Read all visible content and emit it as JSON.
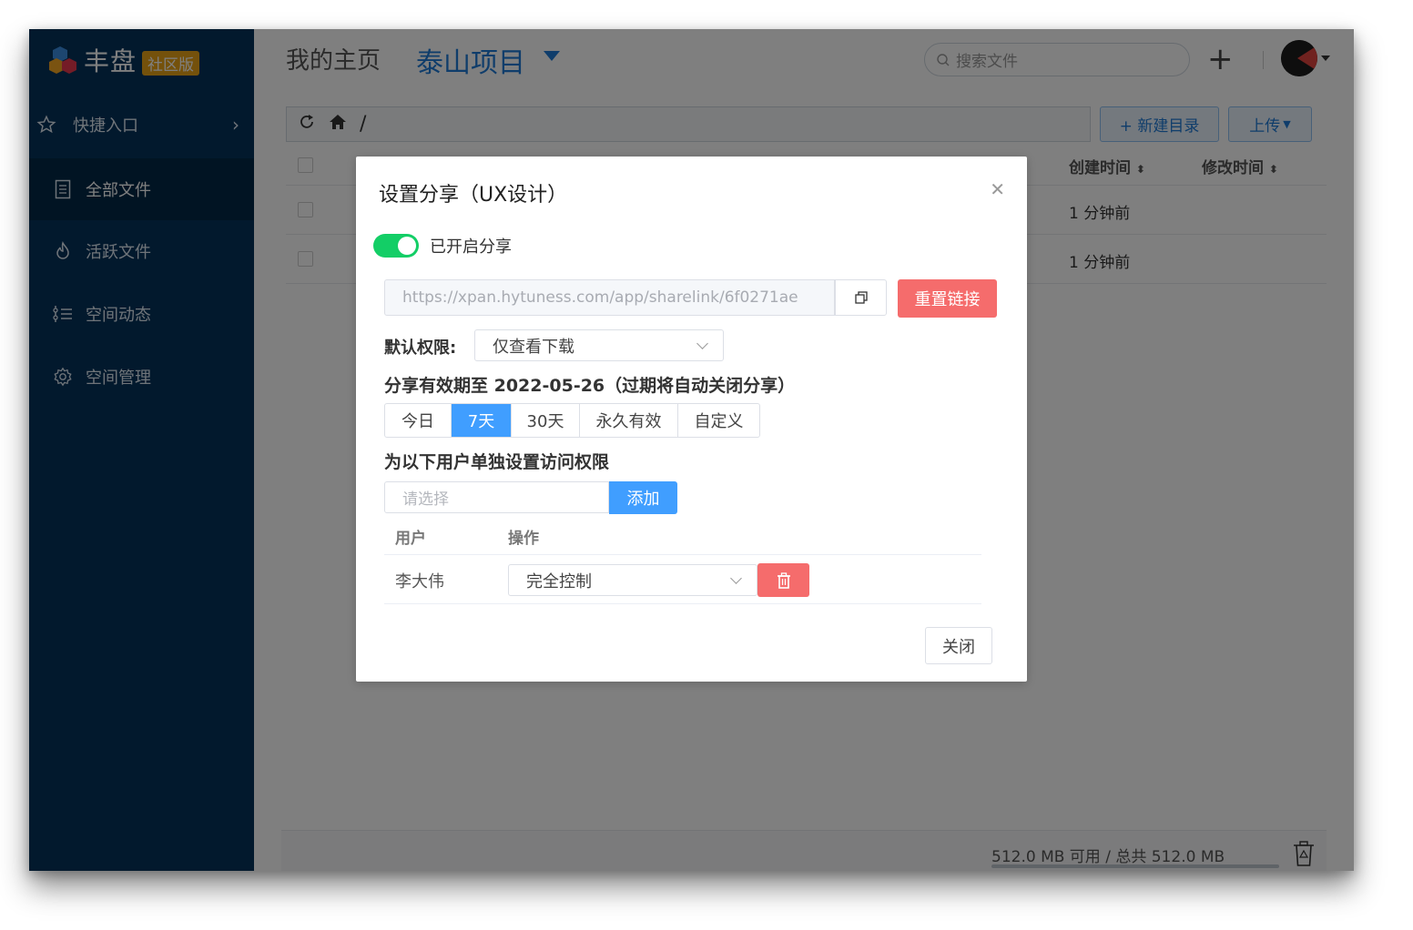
{
  "app": {
    "brand_name": "丰盘",
    "edition": "社区版",
    "accent_color": "#1f7ad6",
    "sidebar_color": "#04325a"
  },
  "sidebar": {
    "quick_entry": "快捷入口",
    "items": [
      {
        "label": "全部文件",
        "icon": "document-icon",
        "active": true
      },
      {
        "label": "活跃文件",
        "icon": "flame-icon",
        "active": false
      },
      {
        "label": "空间动态",
        "icon": "activity-list-icon",
        "active": false
      },
      {
        "label": "空间管理",
        "icon": "gear-icon",
        "active": false
      }
    ]
  },
  "header": {
    "home_label": "我的主页",
    "project_label": "泰山项目",
    "search_placeholder": "搜索文件"
  },
  "toolbar": {
    "path": "/",
    "new_dir_label": "+ 新建目录",
    "upload_label": "上传"
  },
  "table": {
    "columns": [
      "创建时间",
      "修改时间"
    ],
    "rows": [
      {
        "created": "1 分钟前"
      },
      {
        "created": "1 分钟前"
      }
    ]
  },
  "footer": {
    "quota_text": "512.0 MB 可用 / 总共 512.0 MB"
  },
  "share_dialog": {
    "title": "设置分享（UX设计）",
    "enabled": true,
    "enabled_label": "已开启分享",
    "link": "https://xpan.hytuness.com/app/sharelink/6f0271ae",
    "reset_label": "重置链接",
    "default_perm_label": "默认权限:",
    "default_perm_value": "仅查看下载",
    "expire_text": "分享有效期至 2022-05-26（过期将自动关闭分享）",
    "durations": [
      "今日",
      "7天",
      "30天",
      "永久有效",
      "自定义"
    ],
    "selected_duration": "7天",
    "user_perm_title": "为以下用户单独设置访问权限",
    "user_select_placeholder": "请选择",
    "add_label": "添加",
    "user_table": {
      "headers": [
        "用户",
        "操作"
      ],
      "rows": [
        {
          "user": "李大伟",
          "permission": "完全控制"
        }
      ]
    },
    "close_label": "关闭"
  }
}
